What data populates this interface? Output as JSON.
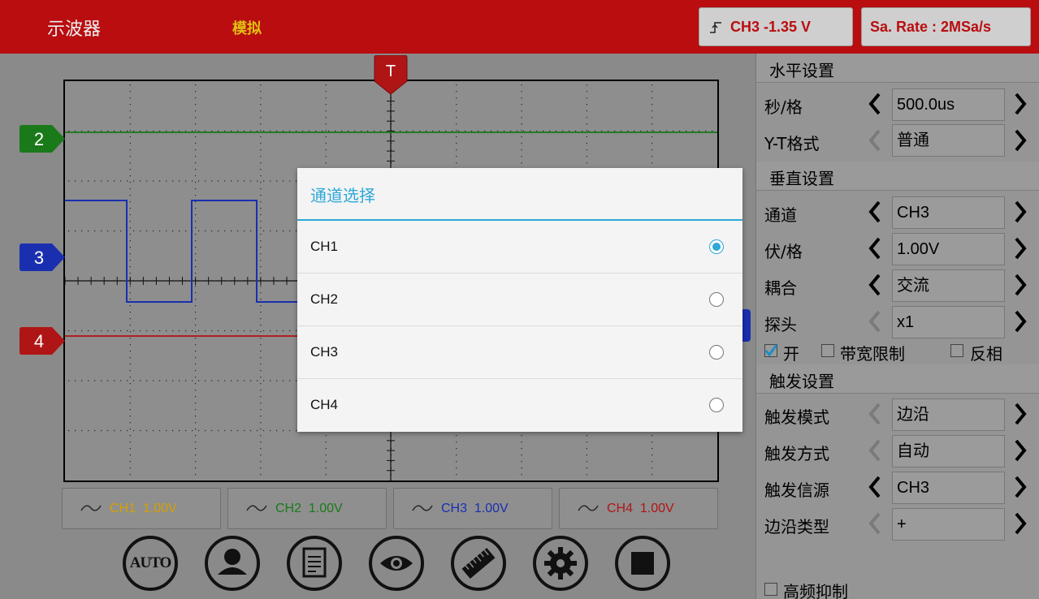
{
  "header": {
    "app_title": "示波器",
    "mode": "模拟",
    "trigger_status": "CH3 -1.35 V",
    "sample_rate": "Sa. Rate : 2MSa/s"
  },
  "scope": {
    "trigger_marker": "T",
    "channel_markers": [
      {
        "label": "2",
        "color": "#1a7a1a"
      },
      {
        "label": "3",
        "color": "#1a2fb0"
      },
      {
        "label": "4",
        "color": "#b01515"
      }
    ],
    "channels": [
      {
        "name": "CH1",
        "scale": "1.00V",
        "color": "#d6a000"
      },
      {
        "name": "CH2",
        "scale": "1.00V",
        "color": "#1a7a1a"
      },
      {
        "name": "CH3",
        "scale": "1.00V",
        "color": "#1a2fb0"
      },
      {
        "name": "CH4",
        "scale": "1.00V",
        "color": "#b01515"
      }
    ],
    "toolbar": [
      "auto-button",
      "user-button",
      "report-button",
      "view-button",
      "measure-button",
      "settings-button",
      "stop-button"
    ],
    "auto_label": "AUTO"
  },
  "panel": {
    "horizontal": {
      "title": "水平设置",
      "time_div_label": "秒/格",
      "time_div_value": "500.0us",
      "yt_label": "Y-T格式",
      "yt_value": "普通"
    },
    "vertical": {
      "title": "垂直设置",
      "channel_label": "通道",
      "channel_value": "CH3",
      "volt_div_label": "伏/格",
      "volt_div_value": "1.00V",
      "coupling_label": "耦合",
      "coupling_value": "交流",
      "probe_label": "探头",
      "probe_value": "x1",
      "on_label": "开",
      "on_checked": true,
      "bw_limit_label": "带宽限制",
      "bw_limit_checked": false,
      "invert_label": "反相",
      "invert_checked": false
    },
    "trigger": {
      "title": "触发设置",
      "mode_label": "触发模式",
      "mode_value": "边沿",
      "type_label": "触发方式",
      "type_value": "自动",
      "source_label": "触发信源",
      "source_value": "CH3",
      "edge_label": "边沿类型",
      "edge_value": "+",
      "hf_reject_label": "高频抑制",
      "hf_reject_checked": false
    }
  },
  "dialog": {
    "title": "通道选择",
    "options": [
      {
        "label": "CH1",
        "selected": true
      },
      {
        "label": "CH2",
        "selected": false
      },
      {
        "label": "CH3",
        "selected": false
      },
      {
        "label": "CH4",
        "selected": false
      }
    ]
  }
}
